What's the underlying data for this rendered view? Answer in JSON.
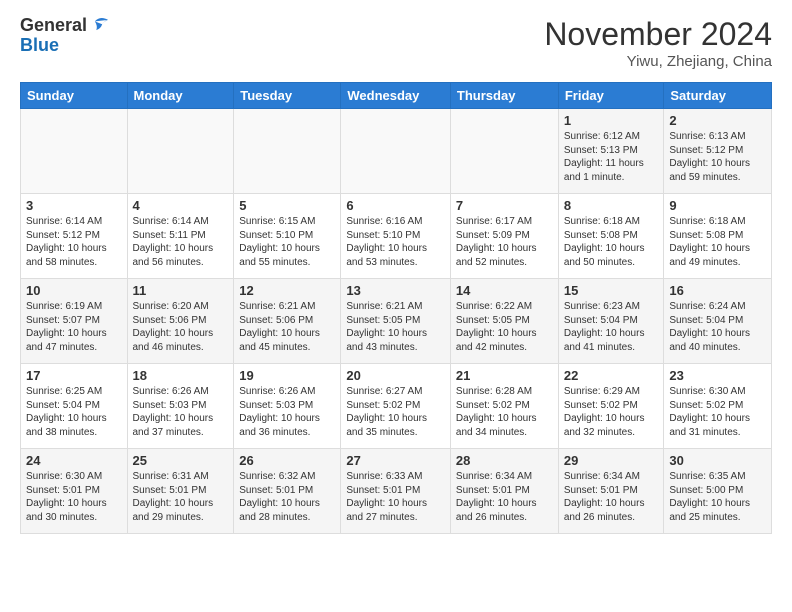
{
  "header": {
    "logo_general": "General",
    "logo_blue": "Blue",
    "month_title": "November 2024",
    "location": "Yiwu, Zhejiang, China"
  },
  "weekdays": [
    "Sunday",
    "Monday",
    "Tuesday",
    "Wednesday",
    "Thursday",
    "Friday",
    "Saturday"
  ],
  "weeks": [
    [
      {
        "day": "",
        "info": ""
      },
      {
        "day": "",
        "info": ""
      },
      {
        "day": "",
        "info": ""
      },
      {
        "day": "",
        "info": ""
      },
      {
        "day": "",
        "info": ""
      },
      {
        "day": "1",
        "info": "Sunrise: 6:12 AM\nSunset: 5:13 PM\nDaylight: 11 hours\nand 1 minute."
      },
      {
        "day": "2",
        "info": "Sunrise: 6:13 AM\nSunset: 5:12 PM\nDaylight: 10 hours\nand 59 minutes."
      }
    ],
    [
      {
        "day": "3",
        "info": "Sunrise: 6:14 AM\nSunset: 5:12 PM\nDaylight: 10 hours\nand 58 minutes."
      },
      {
        "day": "4",
        "info": "Sunrise: 6:14 AM\nSunset: 5:11 PM\nDaylight: 10 hours\nand 56 minutes."
      },
      {
        "day": "5",
        "info": "Sunrise: 6:15 AM\nSunset: 5:10 PM\nDaylight: 10 hours\nand 55 minutes."
      },
      {
        "day": "6",
        "info": "Sunrise: 6:16 AM\nSunset: 5:10 PM\nDaylight: 10 hours\nand 53 minutes."
      },
      {
        "day": "7",
        "info": "Sunrise: 6:17 AM\nSunset: 5:09 PM\nDaylight: 10 hours\nand 52 minutes."
      },
      {
        "day": "8",
        "info": "Sunrise: 6:18 AM\nSunset: 5:08 PM\nDaylight: 10 hours\nand 50 minutes."
      },
      {
        "day": "9",
        "info": "Sunrise: 6:18 AM\nSunset: 5:08 PM\nDaylight: 10 hours\nand 49 minutes."
      }
    ],
    [
      {
        "day": "10",
        "info": "Sunrise: 6:19 AM\nSunset: 5:07 PM\nDaylight: 10 hours\nand 47 minutes."
      },
      {
        "day": "11",
        "info": "Sunrise: 6:20 AM\nSunset: 5:06 PM\nDaylight: 10 hours\nand 46 minutes."
      },
      {
        "day": "12",
        "info": "Sunrise: 6:21 AM\nSunset: 5:06 PM\nDaylight: 10 hours\nand 45 minutes."
      },
      {
        "day": "13",
        "info": "Sunrise: 6:21 AM\nSunset: 5:05 PM\nDaylight: 10 hours\nand 43 minutes."
      },
      {
        "day": "14",
        "info": "Sunrise: 6:22 AM\nSunset: 5:05 PM\nDaylight: 10 hours\nand 42 minutes."
      },
      {
        "day": "15",
        "info": "Sunrise: 6:23 AM\nSunset: 5:04 PM\nDaylight: 10 hours\nand 41 minutes."
      },
      {
        "day": "16",
        "info": "Sunrise: 6:24 AM\nSunset: 5:04 PM\nDaylight: 10 hours\nand 40 minutes."
      }
    ],
    [
      {
        "day": "17",
        "info": "Sunrise: 6:25 AM\nSunset: 5:04 PM\nDaylight: 10 hours\nand 38 minutes."
      },
      {
        "day": "18",
        "info": "Sunrise: 6:26 AM\nSunset: 5:03 PM\nDaylight: 10 hours\nand 37 minutes."
      },
      {
        "day": "19",
        "info": "Sunrise: 6:26 AM\nSunset: 5:03 PM\nDaylight: 10 hours\nand 36 minutes."
      },
      {
        "day": "20",
        "info": "Sunrise: 6:27 AM\nSunset: 5:02 PM\nDaylight: 10 hours\nand 35 minutes."
      },
      {
        "day": "21",
        "info": "Sunrise: 6:28 AM\nSunset: 5:02 PM\nDaylight: 10 hours\nand 34 minutes."
      },
      {
        "day": "22",
        "info": "Sunrise: 6:29 AM\nSunset: 5:02 PM\nDaylight: 10 hours\nand 32 minutes."
      },
      {
        "day": "23",
        "info": "Sunrise: 6:30 AM\nSunset: 5:02 PM\nDaylight: 10 hours\nand 31 minutes."
      }
    ],
    [
      {
        "day": "24",
        "info": "Sunrise: 6:30 AM\nSunset: 5:01 PM\nDaylight: 10 hours\nand 30 minutes."
      },
      {
        "day": "25",
        "info": "Sunrise: 6:31 AM\nSunset: 5:01 PM\nDaylight: 10 hours\nand 29 minutes."
      },
      {
        "day": "26",
        "info": "Sunrise: 6:32 AM\nSunset: 5:01 PM\nDaylight: 10 hours\nand 28 minutes."
      },
      {
        "day": "27",
        "info": "Sunrise: 6:33 AM\nSunset: 5:01 PM\nDaylight: 10 hours\nand 27 minutes."
      },
      {
        "day": "28",
        "info": "Sunrise: 6:34 AM\nSunset: 5:01 PM\nDaylight: 10 hours\nand 26 minutes."
      },
      {
        "day": "29",
        "info": "Sunrise: 6:34 AM\nSunset: 5:01 PM\nDaylight: 10 hours\nand 26 minutes."
      },
      {
        "day": "30",
        "info": "Sunrise: 6:35 AM\nSunset: 5:00 PM\nDaylight: 10 hours\nand 25 minutes."
      }
    ]
  ]
}
